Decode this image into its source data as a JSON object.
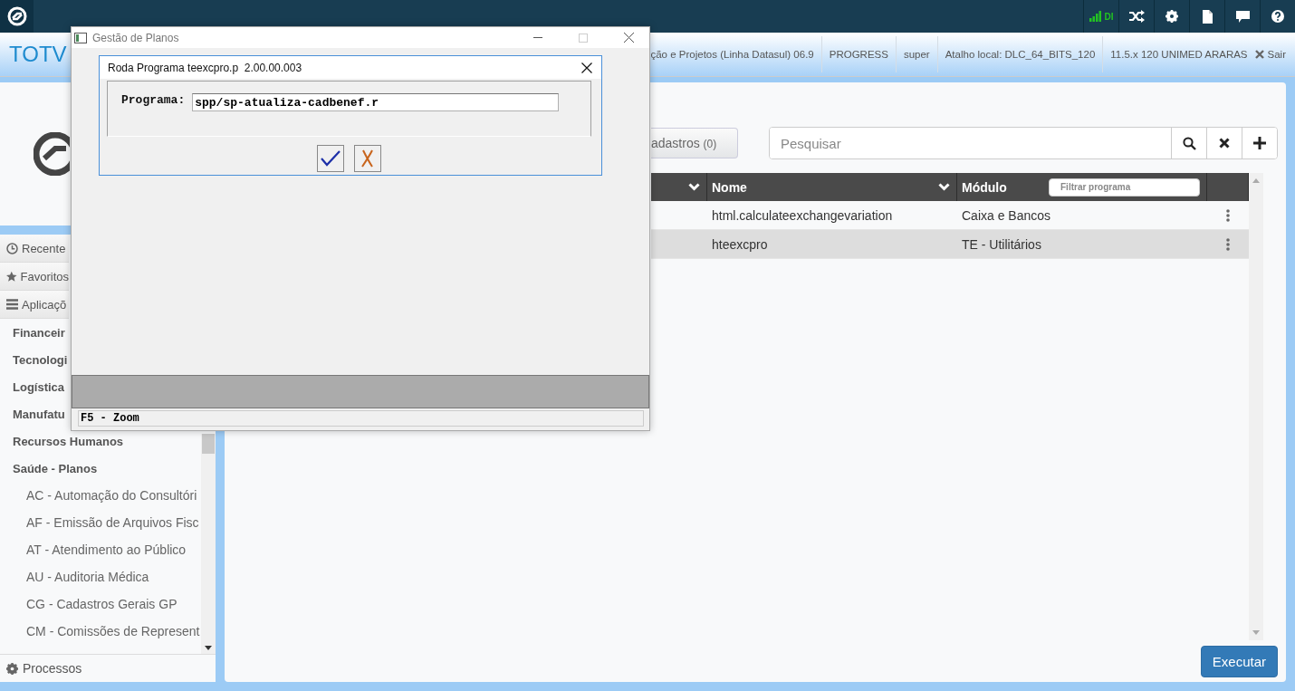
{
  "top_bar": {
    "connection": {
      "label": "DI"
    }
  },
  "header": {
    "brand": "TOTV",
    "status_items": [
      "ção e Projetos (Linha Datasul) 06.9",
      "PROGRESS",
      "super",
      "Atalho local: DLC_64_BITS_120",
      "11.5.x 120 UNIMED ARARAS"
    ],
    "logout": "Sair"
  },
  "sidebar": {
    "sections": [
      {
        "kind": "recent",
        "label": "Recente"
      },
      {
        "kind": "favorites",
        "label": "Favoritos"
      },
      {
        "kind": "applications",
        "label": "Aplicaçõ"
      }
    ],
    "items": [
      {
        "label": "Financeir"
      },
      {
        "label": "Tecnologi"
      },
      {
        "label": "Logística"
      },
      {
        "label": "Manufatu"
      },
      {
        "label": "Recursos Humanos"
      },
      {
        "label": "Saúde - Planos",
        "children": [
          {
            "label": "AC - Automação do Consultóri"
          },
          {
            "label": "AF - Emissão de Arquivos Fisc"
          },
          {
            "label": "AT - Atendimento ao Público"
          },
          {
            "label": "AU - Auditoria Médica"
          },
          {
            "label": "CG - Cadastros Gerais GP"
          },
          {
            "label": "CM - Comissões de Represent"
          }
        ]
      }
    ],
    "footer": "Processos"
  },
  "main": {
    "tab": {
      "label": "adastros",
      "count": "(0)"
    },
    "search": {
      "placeholder": "Pesquisar"
    },
    "table": {
      "columns": [
        {
          "dropdown": true
        },
        {
          "label": "Nome",
          "dropdown": true
        },
        {
          "label": "Módulo",
          "dropdown": false,
          "filter_placeholder": "Filtrar programa"
        }
      ],
      "rows": [
        {
          "nome": "html.calculateexchangevariation",
          "modulo": "Caixa e Bancos",
          "selected": false
        },
        {
          "nome": "hteexcpro",
          "modulo": "TE - Utilitários",
          "selected": true
        }
      ]
    },
    "run_button": "Executar"
  },
  "window": {
    "title": "Gestão de Planos",
    "dialog": {
      "title": "Roda Programa teexcpro.p  2.00.00.003",
      "field_label": "Programa:",
      "field_value": "spp/sp-atualiza-cadbenef.r"
    },
    "status_line": "F5 - Zoom"
  }
}
